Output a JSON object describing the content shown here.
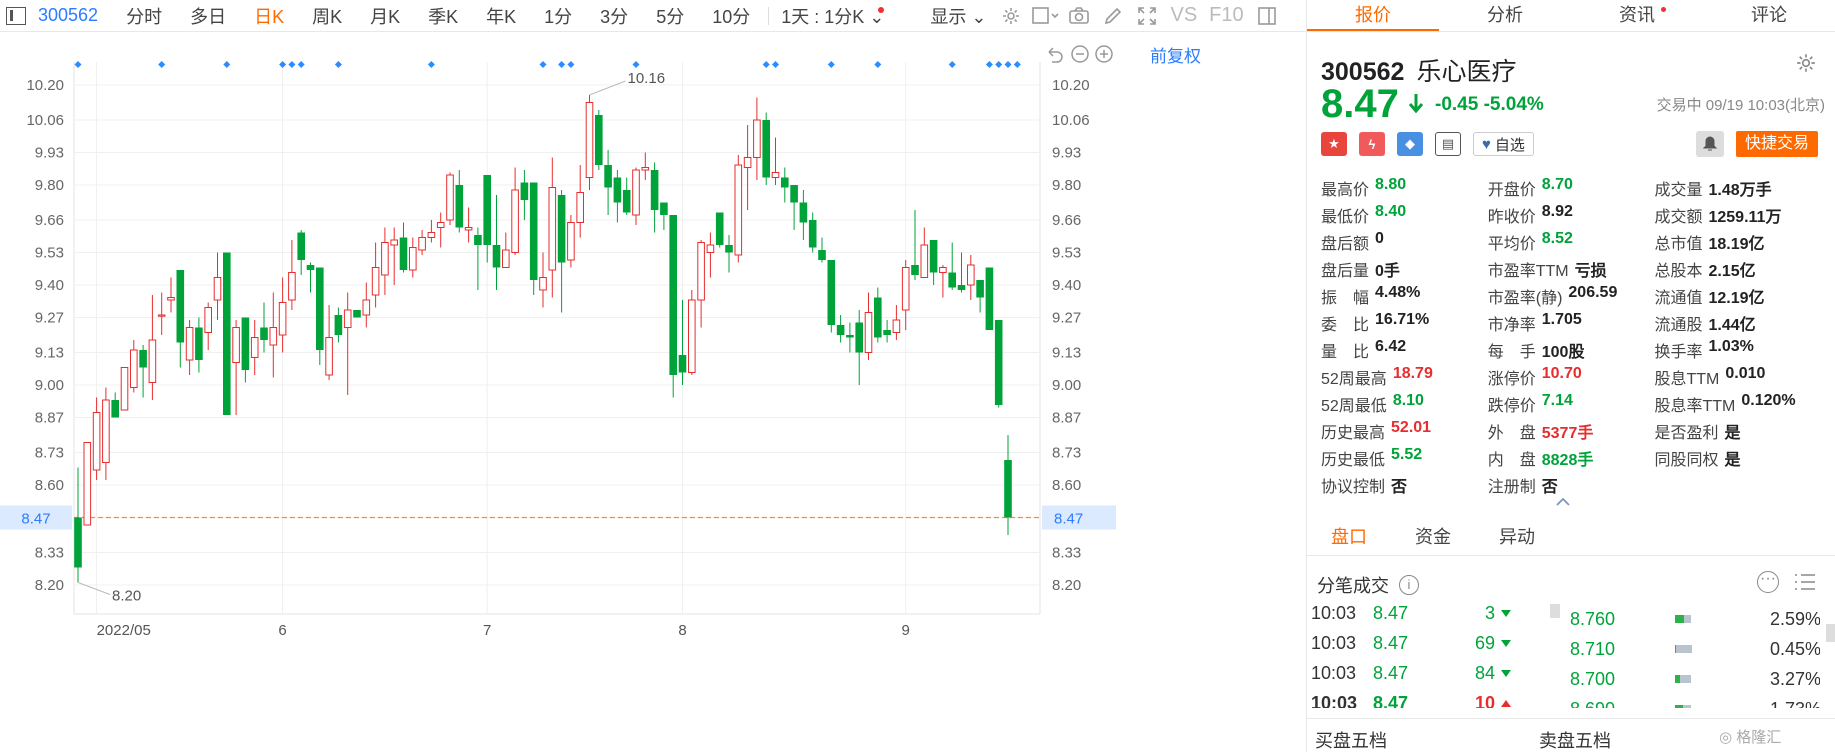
{
  "toolbar": {
    "code": "300562",
    "tabs": [
      "分时",
      "多日",
      "日K",
      "周K",
      "月K",
      "季K",
      "年K",
      "1分",
      "3分",
      "5分",
      "10分"
    ],
    "active_tab": "日K",
    "period_select": "1天 : 1分K",
    "display_select": "显示",
    "vs_label": "VS",
    "f10_label": "F10"
  },
  "chart": {
    "adjust_label": "前复权",
    "month_labels": [
      "2022/05",
      "6",
      "7",
      "8",
      "9"
    ],
    "last_price_tag": "8.47",
    "max_label": "10.16",
    "min_label": "8.20"
  },
  "chart_data": {
    "type": "candlestick",
    "y_ticks": [
      "10.20",
      "10.06",
      "9.93",
      "9.80",
      "9.66",
      "9.53",
      "9.40",
      "9.27",
      "9.13",
      "9.00",
      "8.87",
      "8.73",
      "8.60",
      "8.47",
      "8.33",
      "8.20"
    ],
    "ylim": [
      8.2,
      10.2
    ],
    "reference_line": 8.47,
    "candles": [
      [
        8.47,
        8.27,
        8.67,
        8.21
      ],
      [
        8.44,
        8.77,
        8.77,
        8.44
      ],
      [
        8.66,
        8.89,
        8.95,
        8.62
      ],
      [
        8.69,
        8.94,
        8.99,
        8.62
      ],
      [
        8.94,
        8.87,
        8.97,
        8.87
      ],
      [
        8.9,
        9.07,
        9.07,
        8.9
      ],
      [
        8.99,
        9.14,
        9.18,
        8.97
      ],
      [
        9.14,
        9.07,
        9.16,
        8.95
      ],
      [
        9.01,
        9.18,
        9.36,
        8.94
      ],
      [
        9.28,
        9.28,
        9.37,
        9.2
      ],
      [
        9.34,
        9.35,
        9.43,
        9.29
      ],
      [
        9.46,
        9.17,
        9.46,
        9.07
      ],
      [
        9.1,
        9.23,
        9.26,
        9.04
      ],
      [
        9.23,
        9.1,
        9.27,
        9.05
      ],
      [
        9.21,
        9.31,
        9.33,
        9.14
      ],
      [
        9.34,
        9.43,
        9.53,
        9.26
      ],
      [
        9.53,
        8.88,
        9.53,
        8.9
      ],
      [
        9.09,
        9.23,
        9.26,
        8.88
      ],
      [
        9.27,
        9.06,
        9.27,
        9.01
      ],
      [
        9.11,
        9.19,
        9.26,
        9.04
      ],
      [
        9.23,
        9.18,
        9.33,
        9.13
      ],
      [
        9.16,
        9.23,
        9.37,
        9.03
      ],
      [
        9.2,
        9.33,
        9.43,
        9.13
      ],
      [
        9.34,
        9.45,
        9.58,
        9.3
      ],
      [
        9.61,
        9.5,
        9.62,
        9.44
      ],
      [
        9.48,
        9.46,
        9.49,
        9.37
      ],
      [
        9.47,
        9.14,
        9.47,
        9.08
      ],
      [
        9.04,
        9.19,
        9.32,
        9.02
      ],
      [
        9.28,
        9.2,
        9.31,
        9.17
      ],
      [
        9.23,
        9.3,
        9.37,
        8.96
      ],
      [
        9.3,
        9.27,
        9.3,
        9.28
      ],
      [
        9.28,
        9.34,
        9.41,
        9.23
      ],
      [
        9.36,
        9.47,
        9.57,
        9.31
      ],
      [
        9.44,
        9.57,
        9.63,
        9.36
      ],
      [
        9.56,
        9.58,
        9.63,
        9.4
      ],
      [
        9.59,
        9.46,
        9.65,
        9.45
      ],
      [
        9.46,
        9.55,
        9.59,
        9.43
      ],
      [
        9.54,
        9.59,
        9.62,
        9.52
      ],
      [
        9.59,
        9.61,
        9.66,
        9.57
      ],
      [
        9.63,
        9.65,
        9.69,
        9.55
      ],
      [
        9.66,
        9.84,
        9.85,
        9.64
      ],
      [
        9.8,
        9.63,
        9.86,
        9.61
      ],
      [
        9.62,
        9.63,
        9.71,
        9.57
      ],
      [
        9.6,
        9.56,
        9.63,
        9.38
      ],
      [
        9.84,
        9.56,
        9.84,
        9.49
      ],
      [
        9.56,
        9.47,
        9.76,
        9.38
      ],
      [
        9.47,
        9.54,
        9.61,
        9.47
      ],
      [
        9.53,
        9.78,
        9.87,
        9.52
      ],
      [
        9.81,
        9.74,
        9.86,
        9.66
      ],
      [
        9.81,
        9.42,
        9.81,
        9.36
      ],
      [
        9.38,
        9.43,
        9.53,
        9.31
      ],
      [
        9.46,
        9.79,
        9.91,
        9.35
      ],
      [
        9.76,
        9.49,
        9.78,
        9.29
      ],
      [
        9.5,
        9.65,
        9.68,
        9.47
      ],
      [
        9.65,
        9.77,
        9.88,
        9.59
      ],
      [
        9.83,
        10.13,
        10.16,
        9.78
      ],
      [
        10.08,
        9.88,
        10.1,
        9.86
      ],
      [
        9.88,
        9.79,
        9.94,
        9.68
      ],
      [
        9.83,
        9.73,
        9.86,
        9.65
      ],
      [
        9.78,
        9.69,
        9.83,
        9.68
      ],
      [
        9.68,
        9.86,
        9.87,
        9.64
      ],
      [
        9.86,
        9.87,
        9.93,
        9.82
      ],
      [
        9.86,
        9.7,
        9.89,
        9.61
      ],
      [
        9.73,
        9.68,
        9.73,
        9.62
      ],
      [
        9.68,
        9.04,
        9.68,
        8.95
      ],
      [
        9.12,
        9.05,
        9.34,
        9.0
      ],
      [
        9.05,
        9.34,
        9.38,
        9.04
      ],
      [
        9.34,
        9.57,
        9.58,
        9.23
      ],
      [
        9.53,
        9.56,
        9.61,
        9.43
      ],
      [
        9.69,
        9.56,
        9.69,
        9.55
      ],
      [
        9.56,
        9.53,
        9.6,
        9.45
      ],
      [
        9.52,
        9.88,
        9.92,
        9.49
      ],
      [
        9.87,
        9.91,
        10.04,
        9.7
      ],
      [
        9.91,
        10.06,
        10.15,
        9.82
      ],
      [
        10.06,
        9.83,
        10.09,
        9.8
      ],
      [
        9.83,
        9.85,
        9.99,
        9.8
      ],
      [
        9.83,
        9.79,
        9.87,
        9.73
      ],
      [
        9.8,
        9.73,
        9.8,
        9.62
      ],
      [
        9.73,
        9.65,
        9.78,
        9.58
      ],
      [
        9.66,
        9.55,
        9.69,
        9.53
      ],
      [
        9.54,
        9.5,
        9.59,
        9.49
      ],
      [
        9.5,
        9.24,
        9.5,
        9.21
      ],
      [
        9.24,
        9.2,
        9.28,
        9.17
      ],
      [
        9.2,
        9.19,
        9.25,
        9.13
      ],
      [
        9.25,
        9.13,
        9.3,
        9.0
      ],
      [
        9.13,
        9.29,
        9.37,
        9.1
      ],
      [
        9.35,
        9.19,
        9.39,
        9.17
      ],
      [
        9.22,
        9.2,
        9.26,
        9.17
      ],
      [
        9.21,
        9.26,
        9.32,
        9.18
      ],
      [
        9.3,
        9.47,
        9.5,
        9.22
      ],
      [
        9.48,
        9.44,
        9.7,
        9.42
      ],
      [
        9.43,
        9.56,
        9.63,
        9.43
      ],
      [
        9.58,
        9.45,
        9.58,
        9.4
      ],
      [
        9.45,
        9.47,
        9.48,
        9.35
      ],
      [
        9.45,
        9.39,
        9.57,
        9.38
      ],
      [
        9.4,
        9.38,
        9.53,
        9.37
      ],
      [
        9.4,
        9.48,
        9.52,
        9.34
      ],
      [
        9.42,
        9.35,
        9.42,
        9.29
      ],
      [
        9.47,
        9.22,
        9.47,
        9.26
      ],
      [
        9.26,
        8.92,
        9.26,
        8.91
      ],
      [
        8.7,
        8.47,
        8.8,
        8.4
      ]
    ],
    "marker_indices": [
      0,
      9,
      16,
      22,
      23,
      24,
      28,
      38,
      50,
      52,
      53,
      60,
      74,
      75,
      81,
      86,
      94,
      98,
      99,
      100,
      101
    ]
  },
  "quote": {
    "code": "300562",
    "name": "乐心医疗",
    "price": "8.47",
    "change": "-0.45",
    "change_pct": "-5.04%",
    "trade_status": "交易中 09/19 10:03(北京)",
    "watch_label": "自选",
    "quick_trade_label": "快捷交易"
  },
  "tabs": [
    {
      "label": "报价",
      "active": true
    },
    {
      "label": "分析",
      "active": false
    },
    {
      "label": "资讯",
      "active": false,
      "dot": true
    },
    {
      "label": "评论",
      "active": false
    }
  ],
  "stats": [
    [
      {
        "label": "最高价",
        "value": "8.80",
        "color": "down"
      },
      {
        "label": "开盘价",
        "value": "8.70",
        "color": "down"
      },
      {
        "label": "成交量",
        "value": "1.48万手",
        "color": ""
      }
    ],
    [
      {
        "label": "最低价",
        "value": "8.40",
        "color": "down"
      },
      {
        "label": "昨收价",
        "value": "8.92",
        "color": ""
      },
      {
        "label": "成交额",
        "value": "1259.11万",
        "color": ""
      }
    ],
    [
      {
        "label": "盘后额",
        "value": "0",
        "color": ""
      },
      {
        "label": "平均价",
        "value": "8.52",
        "color": "down"
      },
      {
        "label": "总市值",
        "value": "18.19亿",
        "color": ""
      }
    ],
    [
      {
        "label": "盘后量",
        "value": "0手",
        "color": ""
      },
      {
        "label": "市盈率TTM",
        "value": "亏损",
        "color": ""
      },
      {
        "label": "总股本",
        "value": "2.15亿",
        "color": ""
      }
    ],
    [
      {
        "label": "振　幅",
        "value": "4.48%",
        "color": ""
      },
      {
        "label": "市盈率(静)",
        "value": "206.59",
        "color": ""
      },
      {
        "label": "流通值",
        "value": "12.19亿",
        "color": ""
      }
    ],
    [
      {
        "label": "委　比",
        "value": "16.71%",
        "color": ""
      },
      {
        "label": "市净率",
        "value": "1.705",
        "color": ""
      },
      {
        "label": "流通股",
        "value": "1.44亿",
        "color": ""
      }
    ],
    [
      {
        "label": "量　比",
        "value": "6.42",
        "color": ""
      },
      {
        "label": "每　手",
        "value": "100股",
        "color": ""
      },
      {
        "label": "换手率",
        "value": "1.03%",
        "color": ""
      }
    ],
    [
      {
        "label": "52周最高",
        "value": "18.79",
        "color": "up"
      },
      {
        "label": "涨停价",
        "value": "10.70",
        "color": "up"
      },
      {
        "label": "股息TTM",
        "value": "0.010",
        "color": ""
      }
    ],
    [
      {
        "label": "52周最低",
        "value": "8.10",
        "color": "down"
      },
      {
        "label": "跌停价",
        "value": "7.14",
        "color": "down"
      },
      {
        "label": "股息率TTM",
        "value": "0.120%",
        "color": ""
      }
    ],
    [
      {
        "label": "历史最高",
        "value": "52.01",
        "color": "up"
      },
      {
        "label": "外　盘",
        "value": "5377手",
        "color": "up"
      },
      {
        "label": "是否盈利",
        "value": "是",
        "color": ""
      }
    ],
    [
      {
        "label": "历史最低",
        "value": "5.52",
        "color": "down"
      },
      {
        "label": "内　盘",
        "value": "8828手",
        "color": "down"
      },
      {
        "label": "同股同权",
        "value": "是",
        "color": ""
      }
    ],
    [
      {
        "label": "协议控制",
        "value": "否",
        "color": ""
      },
      {
        "label": "注册制",
        "value": "否",
        "color": ""
      },
      {
        "label": "",
        "value": "",
        "color": ""
      }
    ]
  ],
  "subtabs": [
    "盘口",
    "资金",
    "异动"
  ],
  "fenbi_title": "分笔成交",
  "trades": [
    {
      "time": "10:03",
      "price": "8.47",
      "vol": "3",
      "dir": "down"
    },
    {
      "time": "10:03",
      "price": "8.47",
      "vol": "69",
      "dir": "down"
    },
    {
      "time": "10:03",
      "price": "8.47",
      "vol": "84",
      "dir": "down"
    },
    {
      "time": "10:03",
      "price": "8.47",
      "vol": "10",
      "dir": "up"
    }
  ],
  "distribution": [
    {
      "price": "8.760",
      "pct": "2.59%",
      "buy": 0.6,
      "sell": 0.4
    },
    {
      "price": "8.710",
      "pct": "0.45%",
      "buy": 0.0,
      "sell": 1.0
    },
    {
      "price": "8.700",
      "pct": "3.27%",
      "buy": 0.3,
      "sell": 0.7
    },
    {
      "price": "8.690",
      "pct": "1.73%",
      "buy": 0.5,
      "sell": 0.5
    }
  ],
  "bottom": {
    "buy5": "买盘五档",
    "sell5": "卖盘五档"
  },
  "watermark": "格隆汇",
  "colors": {
    "up": "#e62e2e",
    "down": "#00a33a",
    "accent": "#ff6a00",
    "link": "#2b7cff",
    "marker": "#2b8cff"
  }
}
